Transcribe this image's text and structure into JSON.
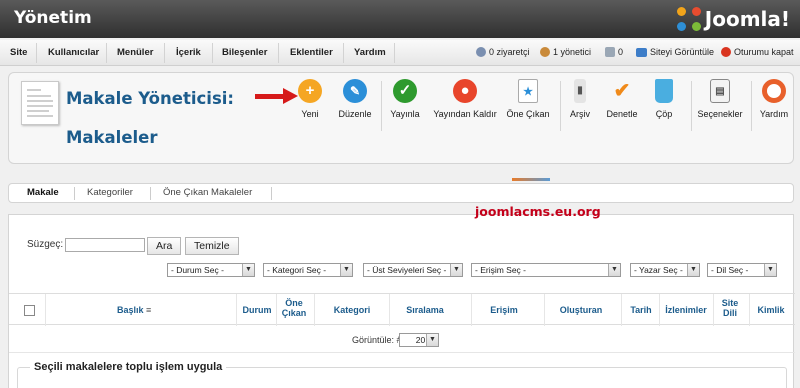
{
  "header": {
    "title": "Yönetim",
    "logo_text": "Joomla!"
  },
  "menu": {
    "items": [
      {
        "label": "Site"
      },
      {
        "label": "Kullanıcılar"
      },
      {
        "label": "Menüler"
      },
      {
        "label": "İçerik"
      },
      {
        "label": "Bileşenler"
      },
      {
        "label": "Eklentiler"
      },
      {
        "label": "Yardım"
      }
    ],
    "status": [
      {
        "label": "0 ziyaretçi",
        "icon": "visitor-icon"
      },
      {
        "label": "1 yönetici",
        "icon": "admin-icon"
      },
      {
        "label": "0",
        "icon": "messages-icon"
      },
      {
        "label": "Siteyi Görüntüle",
        "icon": "monitor-icon"
      },
      {
        "label": "Oturumu kapat",
        "icon": "logout-icon"
      }
    ]
  },
  "toolbar": {
    "title_line1": "Makale Yöneticisi:",
    "title_line2": "Makaleler",
    "buttons": [
      {
        "label": "Yeni",
        "icon": "plus-icon",
        "color": "#f5a623"
      },
      {
        "label": "Düzenle",
        "icon": "pencil-icon",
        "color": "#2b8fd8"
      },
      {
        "label": "Yayınla",
        "icon": "check-icon",
        "color": "#2e9a2e"
      },
      {
        "label": "Yayından Kaldır",
        "icon": "unpublish-icon",
        "color": "#e8452b"
      },
      {
        "label": "Öne Çıkan",
        "icon": "featured-icon",
        "color": "#2b8fd8"
      },
      {
        "label": "Arşiv",
        "icon": "archive-icon",
        "color": "#555555"
      },
      {
        "label": "Denetle",
        "icon": "checkmark-icon",
        "color": "#f08a1a"
      },
      {
        "label": "Çöp",
        "icon": "trash-icon",
        "color": "#4aaee0"
      },
      {
        "label": "Seçenekler",
        "icon": "options-icon",
        "color": "#777777"
      },
      {
        "label": "Yardım",
        "icon": "help-icon",
        "color": "#e8602b"
      }
    ]
  },
  "subnav": {
    "tabs": [
      {
        "label": "Makale"
      },
      {
        "label": "Kategoriler"
      },
      {
        "label": "Öne Çıkan Makaleler"
      }
    ]
  },
  "watermark": "joomlacms.eu.org",
  "filters": {
    "search_label": "Süzgeç:",
    "search_value": "",
    "search_button": "Ara",
    "clear_button": "Temizle",
    "selects": [
      {
        "value": "- Durum Seç -"
      },
      {
        "value": "- Kategori Seç -"
      },
      {
        "value": "- Üst Seviyeleri Seç -"
      },
      {
        "value": "- Erişim Seç -"
      },
      {
        "value": "- Yazar Seç -"
      },
      {
        "value": "- Dil Seç -"
      }
    ]
  },
  "table": {
    "columns": [
      {
        "label": "Başlık"
      },
      {
        "label": "Durum"
      },
      {
        "label": "Öne Çıkan"
      },
      {
        "label": "Kategori"
      },
      {
        "label": "Sıralama"
      },
      {
        "label": "Erişim"
      },
      {
        "label": "Oluşturan"
      },
      {
        "label": "Tarih"
      },
      {
        "label": "İzlenimler"
      },
      {
        "label": "Site Dili"
      },
      {
        "label": "Kimlik"
      }
    ]
  },
  "pager": {
    "label": "Görüntüle: #",
    "value": "20"
  },
  "batch": {
    "legend": "Seçili makalelere toplu işlem uygula"
  }
}
